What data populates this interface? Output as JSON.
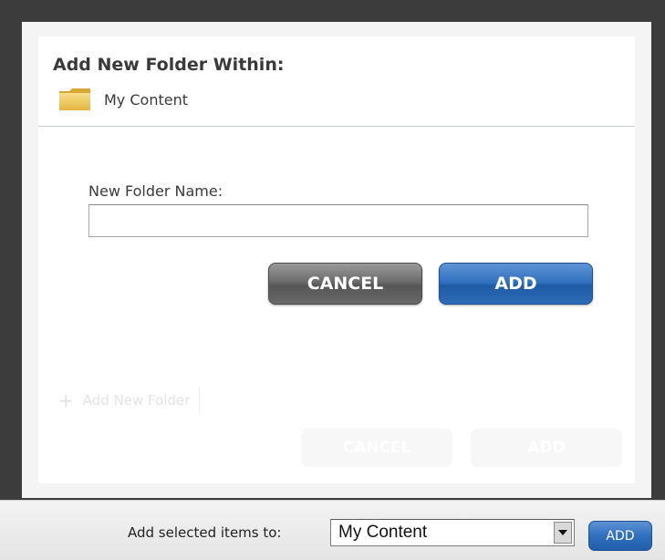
{
  "dialog": {
    "title": "Add New Folder Within:",
    "location": {
      "label": "My Content",
      "icon": "folder-icon"
    },
    "field_label": "New Folder Name:",
    "field_value": "",
    "field_placeholder": "",
    "cancel_label": "CANCEL",
    "add_label": "ADD"
  },
  "background_dialog": {
    "add_folder_label": "Add New Folder",
    "cancel_label": "CANCEL",
    "add_label": "ADD"
  },
  "bottom_bar": {
    "label": "Add selected items to:",
    "selected_option": "My Content",
    "add_label": "ADD"
  },
  "colors": {
    "frame": "#3c3c3c",
    "cancel_button": "#6c6c6c",
    "add_button": "#2f6fbd",
    "folder": "#f2c94c"
  }
}
